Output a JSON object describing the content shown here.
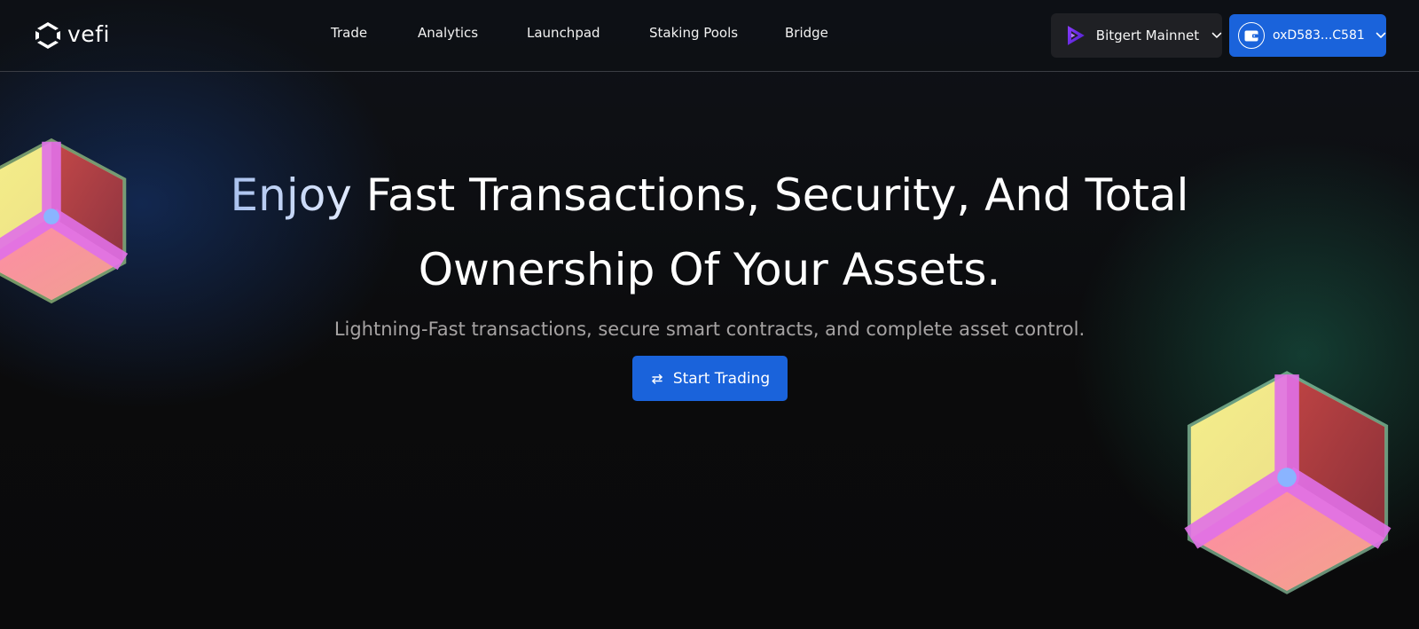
{
  "brand": {
    "name": "vefi"
  },
  "nav": {
    "items": [
      {
        "label": "Trade"
      },
      {
        "label": "Analytics"
      },
      {
        "label": "Launchpad"
      },
      {
        "label": "Staking Pools"
      },
      {
        "label": "Bridge"
      }
    ],
    "network": {
      "label": "Bitgert Mainnet",
      "icon": "bitgert-logo-icon"
    },
    "wallet": {
      "label": "oxD583...C581",
      "icon": "wallet-icon"
    }
  },
  "hero": {
    "title_line1_part1": "Enjoy ",
    "title_line1_part2": "Fast Transactions, Security, And Total",
    "title_line2": "Ownership Of Your Assets.",
    "subtitle": "Lightning-Fast transactions, secure smart contracts, and complete asset control.",
    "cta": {
      "label": "Start Trading",
      "icon": "swap-arrows-icon"
    }
  },
  "colors": {
    "accent": "#1a63db",
    "background": "#0b0b0c",
    "network_button": "#1f2024",
    "subtitle": "#a6a3a3"
  }
}
